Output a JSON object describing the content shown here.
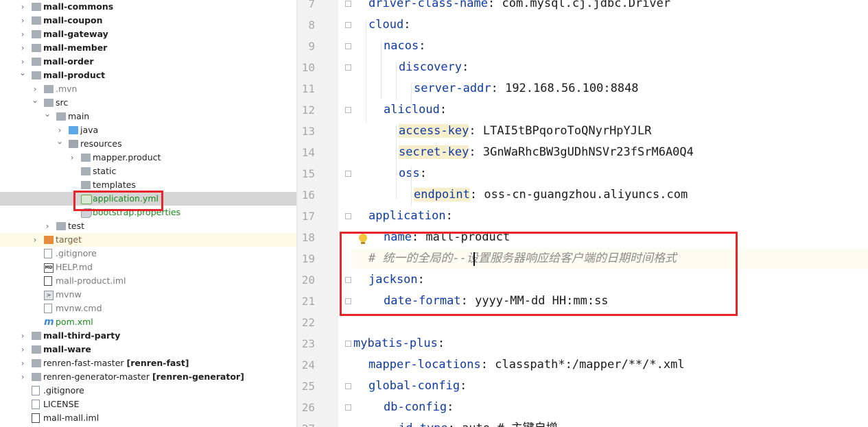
{
  "tree": {
    "items": [
      {
        "label": "mall-commons",
        "suffix": ""
      },
      {
        "label": "mall-coupon",
        "suffix": ""
      },
      {
        "label": "mall-gateway",
        "suffix": ""
      },
      {
        "label": "mall-member",
        "suffix": ""
      },
      {
        "label": "mall-order",
        "suffix": ""
      },
      {
        "label": "mall-product",
        "suffix": ""
      },
      {
        "label": ".mvn",
        "suffix": ""
      },
      {
        "label": "src",
        "suffix": ""
      },
      {
        "label": "main",
        "suffix": ""
      },
      {
        "label": "java",
        "suffix": ""
      },
      {
        "label": "resources",
        "suffix": ""
      },
      {
        "label": "mapper.product",
        "suffix": ""
      },
      {
        "label": "static",
        "suffix": ""
      },
      {
        "label": "templates",
        "suffix": ""
      },
      {
        "label": "application.yml",
        "suffix": ""
      },
      {
        "label": "bootstrap.properties",
        "suffix": ""
      },
      {
        "label": "test",
        "suffix": ""
      },
      {
        "label": "target",
        "suffix": ""
      },
      {
        "label": ".gitignore",
        "suffix": ""
      },
      {
        "label": "HELP.md",
        "suffix": ""
      },
      {
        "label": "mall-product.iml",
        "suffix": ""
      },
      {
        "label": "mvnw",
        "suffix": ""
      },
      {
        "label": "mvnw.cmd",
        "suffix": ""
      },
      {
        "label": "pom.xml",
        "suffix": ""
      },
      {
        "label": "mall-third-party",
        "suffix": ""
      },
      {
        "label": "mall-ware",
        "suffix": ""
      },
      {
        "label": "renren-fast-master ",
        "suffix": "[renren-fast]"
      },
      {
        "label": "renren-generator-master ",
        "suffix": "[renren-generator]"
      },
      {
        "label": ".gitignore",
        "suffix": ""
      },
      {
        "label": "LICENSE",
        "suffix": ""
      },
      {
        "label": "mall-mall.iml",
        "suffix": ""
      }
    ],
    "md_icon_text": "MD",
    "sh_icon_text": ">",
    "maven_icon_text": "m"
  },
  "editor": {
    "lines": [
      {
        "n": "7",
        "key": "driver-class-name",
        "val": " com.mysql.cj.jdbc.Driver",
        "sep": ":"
      },
      {
        "n": "8",
        "key": "cloud",
        "val": "",
        "sep": ":"
      },
      {
        "n": "9",
        "key": "nacos",
        "val": "",
        "sep": ":"
      },
      {
        "n": "10",
        "key": "discovery",
        "val": "",
        "sep": ":"
      },
      {
        "n": "11",
        "key": "server-addr",
        "val": " 192.168.56.100:8848",
        "sep": ":"
      },
      {
        "n": "12",
        "key": "alicloud",
        "val": "",
        "sep": ":"
      },
      {
        "n": "13",
        "key": "access-key",
        "val": " LTAI5tBPqoroToQNyrHpYJLR",
        "sep": ":"
      },
      {
        "n": "14",
        "key": "secret-key",
        "val": " 3GnWaRhcBW3gUDhNSVr23fSrM6A0Q4",
        "sep": ":"
      },
      {
        "n": "15",
        "key": "oss",
        "val": "",
        "sep": ":"
      },
      {
        "n": "16",
        "key": "endpoint",
        "val": " oss-cn-guangzhou.aliyuncs.com",
        "sep": ":"
      },
      {
        "n": "17",
        "key": "application",
        "val": "",
        "sep": ":"
      },
      {
        "n": "18",
        "key": "name",
        "val": " mall-product",
        "sep": ":"
      },
      {
        "n": "19",
        "comment": "# 统一的全局的--设置服务器响应给客户端的日期时间格式"
      },
      {
        "n": "20",
        "key": "jackson",
        "val": "",
        "sep": ":"
      },
      {
        "n": "21",
        "key": "date-format",
        "val": " yyyy-MM-dd HH:mm:ss",
        "sep": ":"
      },
      {
        "n": "22",
        "key": "",
        "val": "",
        "sep": ""
      },
      {
        "n": "23",
        "key": "mybatis-plus",
        "val": "",
        "sep": ":"
      },
      {
        "n": "24",
        "key": "mapper-locations",
        "val": " classpath*:/mapper/**/*.xml",
        "sep": ":"
      },
      {
        "n": "25",
        "key": "global-config",
        "val": "",
        "sep": ":"
      },
      {
        "n": "26",
        "key": "db-config",
        "val": "",
        "sep": ":"
      },
      {
        "n": "27",
        "key": "id-type",
        "val": " auto # 主键自增",
        "sep": ":"
      }
    ]
  },
  "colors": {
    "highlight_box": "#e8242a",
    "yaml_key": "#0e3aa6",
    "comment": "#8c8c8c"
  }
}
